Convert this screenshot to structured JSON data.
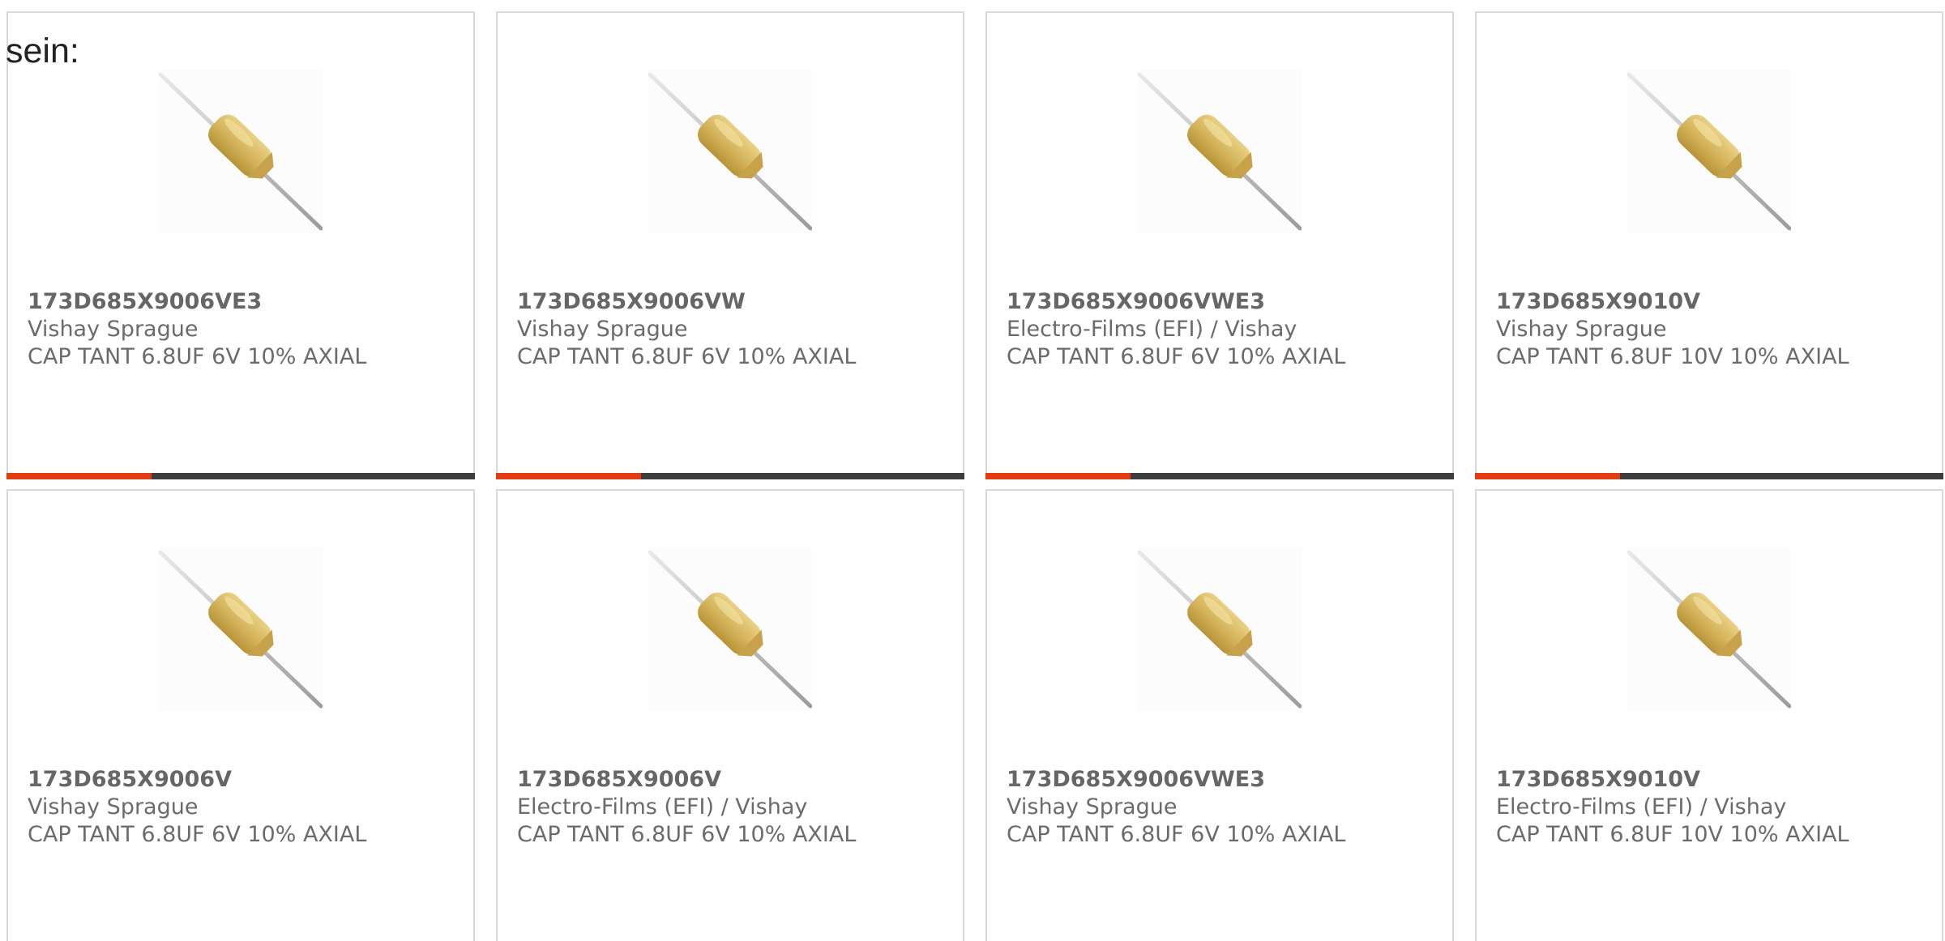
{
  "intro_text": "sein:",
  "colors": {
    "accent": "#e23c14",
    "bar": "#3d3d3d",
    "text": "#6b6b6b",
    "border": "#d9d9d9"
  },
  "cards": [
    {
      "part": "173D685X9006VE3",
      "manufacturer": "Vishay Sprague",
      "description": "CAP TANT 6.8UF 6V 10% AXIAL",
      "image": "axial-tantalum-capacitor-image",
      "progress": 0.31
    },
    {
      "part": "173D685X9006VW",
      "manufacturer": "Vishay Sprague",
      "description": "CAP TANT 6.8UF 6V 10% AXIAL",
      "image": "axial-tantalum-capacitor-image",
      "progress": 0.31
    },
    {
      "part": "173D685X9006VWE3",
      "manufacturer": "Electro-Films (EFI) / Vishay",
      "description": "CAP TANT 6.8UF 6V 10% AXIAL",
      "image": "axial-tantalum-capacitor-image",
      "progress": 0.31
    },
    {
      "part": "173D685X9010V",
      "manufacturer": "Vishay Sprague",
      "description": "CAP TANT 6.8UF 10V 10% AXIAL",
      "image": "axial-tantalum-capacitor-image",
      "progress": 0.31
    },
    {
      "part": "173D685X9006V",
      "manufacturer": "Vishay Sprague",
      "description": "CAP TANT 6.8UF 6V 10% AXIAL",
      "image": "axial-tantalum-capacitor-image"
    },
    {
      "part": "173D685X9006V",
      "manufacturer": "Electro-Films (EFI) / Vishay",
      "description": "CAP TANT 6.8UF 6V 10% AXIAL",
      "image": "axial-tantalum-capacitor-image"
    },
    {
      "part": "173D685X9006VWE3",
      "manufacturer": "Vishay Sprague",
      "description": "CAP TANT 6.8UF 6V 10% AXIAL",
      "image": "axial-tantalum-capacitor-image"
    },
    {
      "part": "173D685X9010V",
      "manufacturer": "Electro-Films (EFI) / Vishay",
      "description": "CAP TANT 6.8UF 10V 10% AXIAL",
      "image": "axial-tantalum-capacitor-image"
    }
  ]
}
